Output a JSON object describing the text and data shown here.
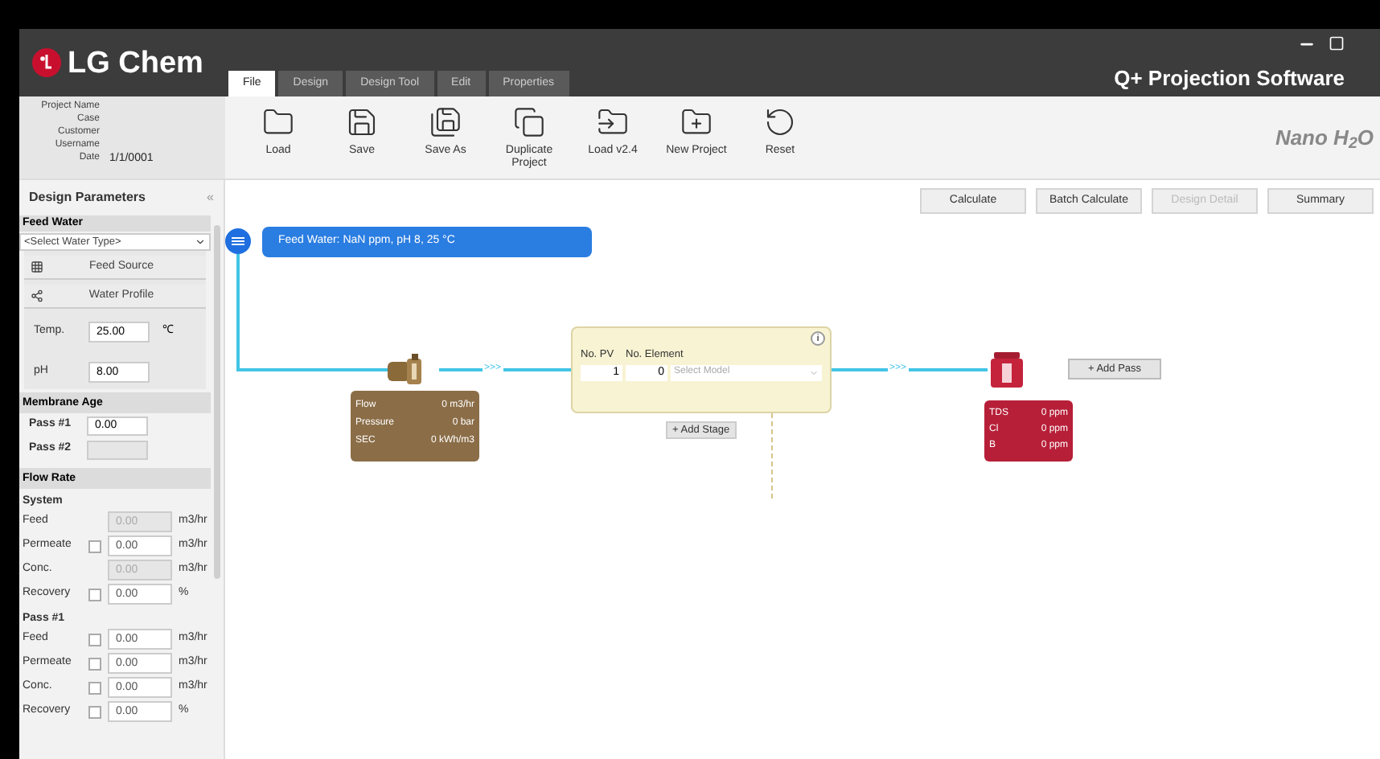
{
  "header": {
    "logo": "LG Chem",
    "title": "Q+ Projection Software",
    "brand": "Nano H$_{2}$O"
  },
  "tabs": [
    {
      "label": "File",
      "selected": true
    },
    {
      "label": "Design",
      "selected": false
    },
    {
      "label": "Design Tool",
      "selected": false
    },
    {
      "label": "Edit",
      "selected": false
    },
    {
      "label": "Properties",
      "selected": false
    }
  ],
  "project_info": [
    {
      "label": "Project Name"
    },
    {
      "label": "Case"
    },
    {
      "label": "Customer"
    },
    {
      "label": "Username"
    },
    {
      "label": "Date",
      "value": "1/1/0001"
    }
  ],
  "ribbon": [
    {
      "label": "Load"
    },
    {
      "label": "Save"
    },
    {
      "label": "Save As"
    },
    {
      "label": "Duplicate Project"
    },
    {
      "label": "Load v2.4"
    },
    {
      "label": "New Project"
    },
    {
      "label": "Reset"
    }
  ],
  "actions": [
    {
      "label": "Calculate",
      "disabled": false
    },
    {
      "label": "Batch Calculate",
      "disabled": false
    },
    {
      "label": "Design Detail",
      "disabled": true
    },
    {
      "label": "Summary",
      "disabled": false
    }
  ],
  "sidebar": {
    "title": "Design Parameters",
    "collapse": "«",
    "feed_water": {
      "heading": "Feed Water",
      "select": {
        "placeholder": "<Select Water Type>"
      },
      "buttons": [
        "Feed Source",
        "Water Profile"
      ],
      "fields": [
        {
          "label": "Temp.",
          "value": "25.00",
          "unit": "℃"
        },
        {
          "label": "pH",
          "value": "8.00"
        }
      ]
    },
    "membrane_age": {
      "heading": "Membrane Age",
      "rows": [
        {
          "label": "Pass #1",
          "value": "0.00",
          "disabled": false
        },
        {
          "label": "Pass #2",
          "disabled": true
        }
      ]
    },
    "flow_rate": {
      "heading": "Flow Rate",
      "groups": [
        {
          "title": "System",
          "rows": [
            {
              "label": "Feed",
              "kind": "plain",
              "value": "0.00",
              "unit": "m3/hr",
              "disabled": true
            },
            {
              "label": "Permeate",
              "kind": "check",
              "checked": false,
              "value": "0.00",
              "unit": "m3/hr",
              "disabled": false
            },
            {
              "label": "Conc.",
              "kind": "plain",
              "value": "0.00",
              "unit": "m3/hr",
              "disabled": true
            },
            {
              "label": "Recovery",
              "kind": "check",
              "checked": false,
              "value": "0.00",
              "unit": "%",
              "disabled": false
            }
          ]
        },
        {
          "title": "Pass #1",
          "rows": [
            {
              "label": "Feed",
              "kind": "check",
              "checked": false,
              "value": "0.00",
              "unit": "m3/hr",
              "disabled": false
            },
            {
              "label": "Permeate",
              "kind": "check",
              "checked": false,
              "value": "0.00",
              "unit": "m3/hr",
              "disabled": false
            },
            {
              "label": "Conc.",
              "kind": "check",
              "checked": false,
              "value": "0.00",
              "unit": "m3/hr",
              "disabled": false
            },
            {
              "label": "Recovery",
              "kind": "check",
              "checked": false,
              "value": "0.00",
              "unit": "%",
              "disabled": false
            }
          ]
        }
      ]
    }
  },
  "canvas": {
    "feed_label": "Feed Water: NaN ppm, pH 8, 25 °C",
    "flow_marks": [
      ">>>",
      ">>>"
    ],
    "pump": [
      {
        "label": "Flow",
        "value": "0 m3/hr"
      },
      {
        "label": "Pressure",
        "value": "0 bar"
      },
      {
        "label": "SEC",
        "value": "0 kWh/m3"
      }
    ],
    "stage": {
      "info": "i",
      "headers": [
        "No. PV",
        "No. Element"
      ],
      "pv": "1",
      "elements": "0",
      "model": {
        "placeholder": "Select Model"
      },
      "add_stage": "+ Add Stage"
    },
    "product": [
      {
        "label": "TDS",
        "value": "0 ppm"
      },
      {
        "label": "Cl",
        "value": "0 ppm"
      },
      {
        "label": "B",
        "value": "0 ppm"
      }
    ],
    "add_pass": "+ Add Pass"
  }
}
